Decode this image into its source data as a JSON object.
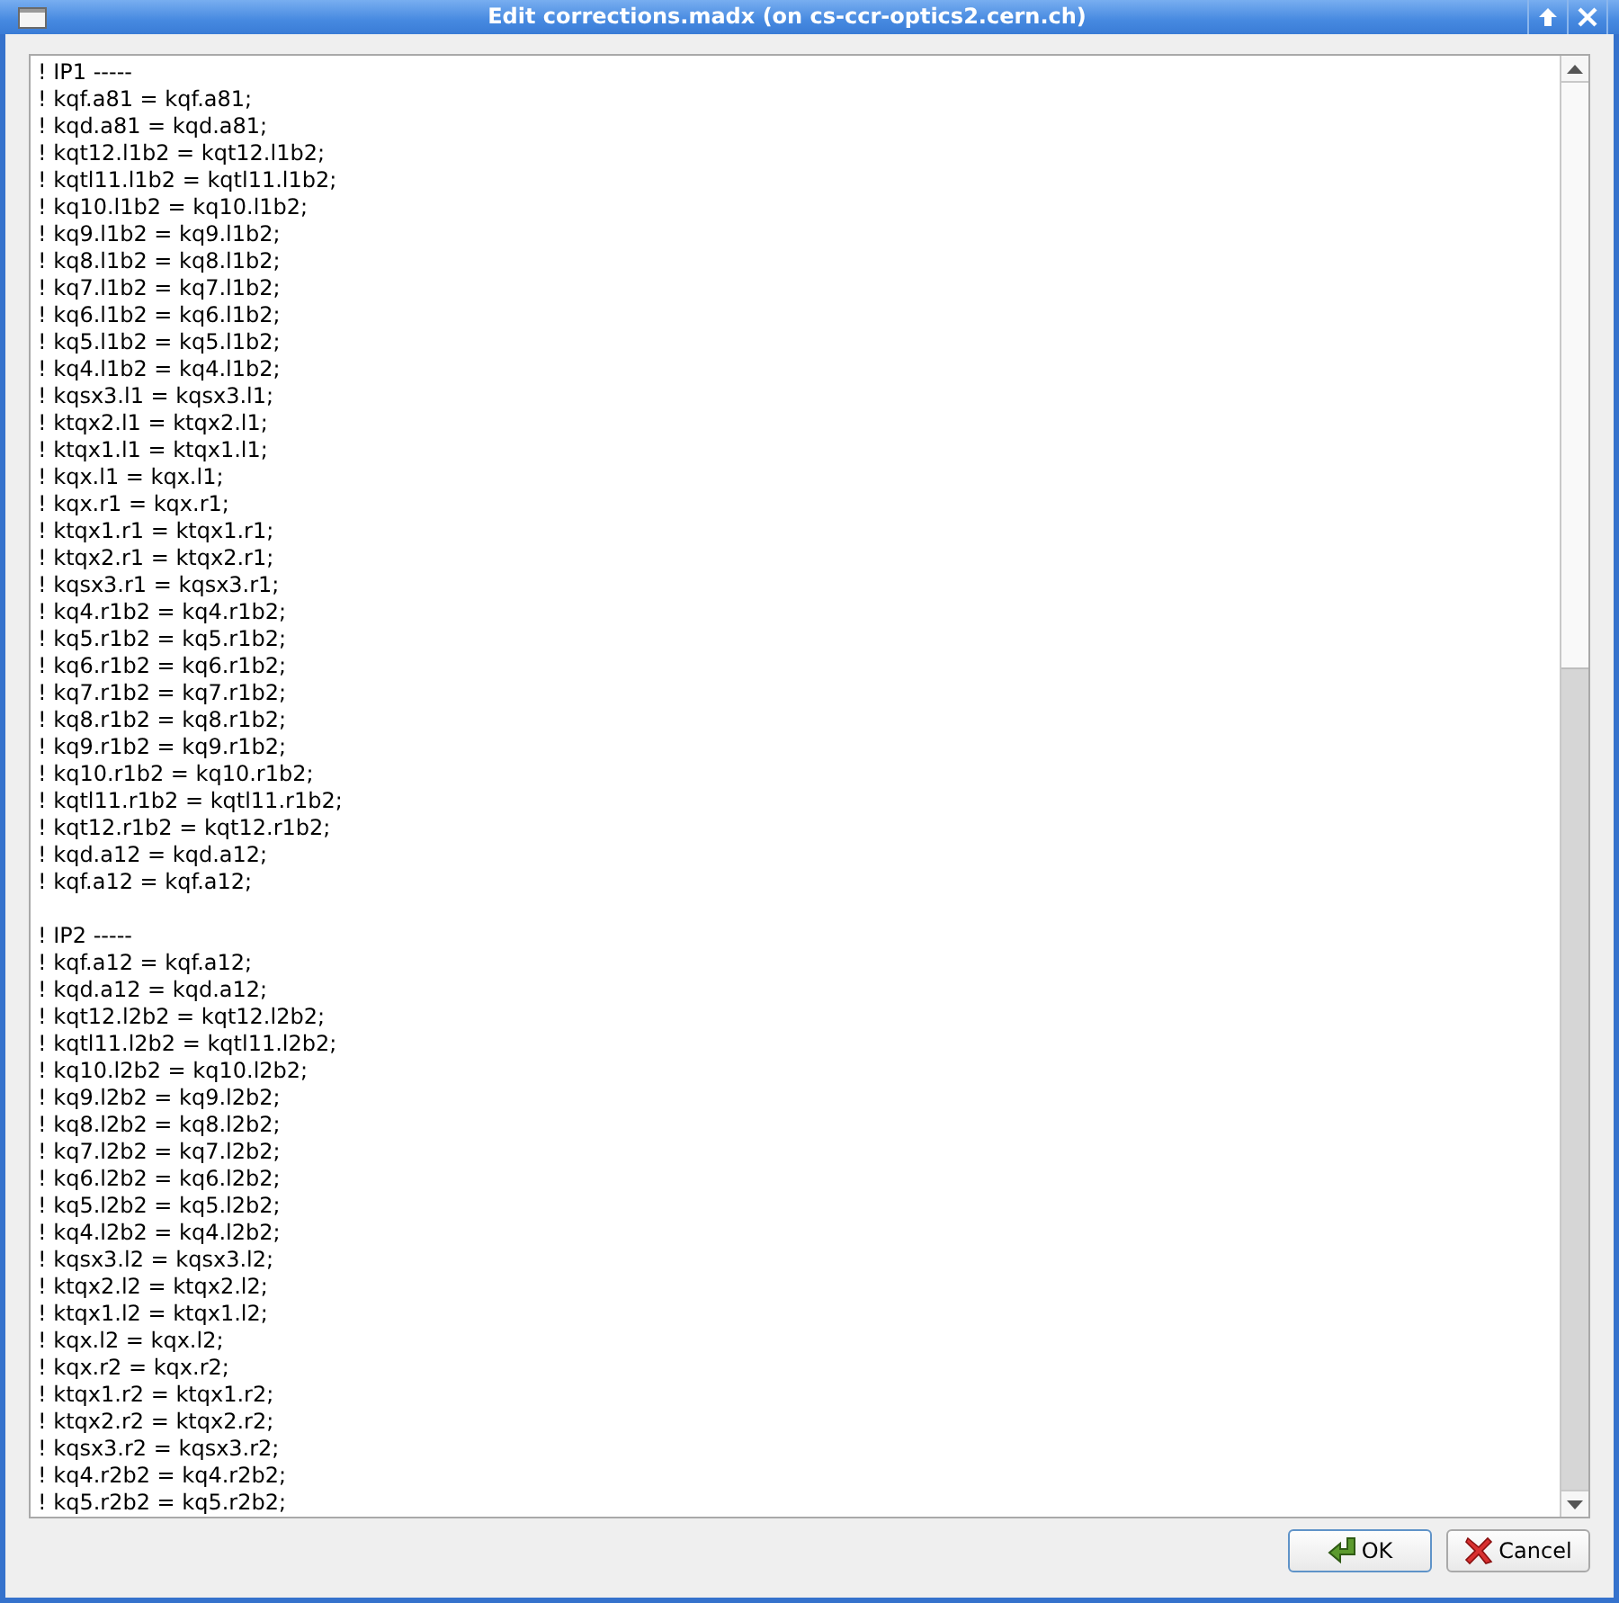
{
  "window": {
    "title": "Edit corrections.madx (on cs-ccr-optics2.cern.ch)"
  },
  "editor": {
    "sections": [
      {
        "header": "! IP1 -----",
        "lines": [
          "! kqf.a81 = kqf.a81;",
          "! kqd.a81 = kqd.a81;",
          "! kqt12.l1b2 = kqt12.l1b2;",
          "! kqtl11.l1b2 = kqtl11.l1b2;",
          "! kq10.l1b2 = kq10.l1b2;",
          "! kq9.l1b2 = kq9.l1b2;",
          "! kq8.l1b2 = kq8.l1b2;",
          "! kq7.l1b2 = kq7.l1b2;",
          "! kq6.l1b2 = kq6.l1b2;",
          "! kq5.l1b2 = kq5.l1b2;",
          "! kq4.l1b2 = kq4.l1b2;",
          "! kqsx3.l1 = kqsx3.l1;",
          "! ktqx2.l1 = ktqx2.l1;",
          "! ktqx1.l1 = ktqx1.l1;",
          "! kqx.l1 = kqx.l1;",
          "! kqx.r1 = kqx.r1;",
          "! ktqx1.r1 = ktqx1.r1;",
          "! ktqx2.r1 = ktqx2.r1;",
          "! kqsx3.r1 = kqsx3.r1;",
          "! kq4.r1b2 = kq4.r1b2;",
          "! kq5.r1b2 = kq5.r1b2;",
          "! kq6.r1b2 = kq6.r1b2;",
          "! kq7.r1b2 = kq7.r1b2;",
          "! kq8.r1b2 = kq8.r1b2;",
          "! kq9.r1b2 = kq9.r1b2;",
          "! kq10.r1b2 = kq10.r1b2;",
          "! kqtl11.r1b2 = kqtl11.r1b2;",
          "! kqt12.r1b2 = kqt12.r1b2;",
          "! kqd.a12 = kqd.a12;",
          "! kqf.a12 = kqf.a12;"
        ]
      },
      {
        "header": "! IP2 -----",
        "lines": [
          "! kqf.a12 = kqf.a12;",
          "! kqd.a12 = kqd.a12;",
          "! kqt12.l2b2 = kqt12.l2b2;",
          "! kqtl11.l2b2 = kqtl11.l2b2;",
          "! kq10.l2b2 = kq10.l2b2;",
          "! kq9.l2b2 = kq9.l2b2;",
          "! kq8.l2b2 = kq8.l2b2;",
          "! kq7.l2b2 = kq7.l2b2;",
          "! kq6.l2b2 = kq6.l2b2;",
          "! kq5.l2b2 = kq5.l2b2;",
          "! kq4.l2b2 = kq4.l2b2;",
          "! kqsx3.l2 = kqsx3.l2;",
          "! ktqx2.l2 = ktqx2.l2;",
          "! ktqx1.l2 = ktqx1.l2;",
          "! kqx.l2 = kqx.l2;",
          "! kqx.r2 = kqx.r2;",
          "! ktqx1.r2 = ktqx1.r2;",
          "! ktqx2.r2 = ktqx2.r2;",
          "! kqsx3.r2 = kqsx3.r2;",
          "! kq4.r2b2 = kq4.r2b2;",
          "! kq5.r2b2 = kq5.r2b2;"
        ]
      }
    ]
  },
  "buttons": [
    {
      "kind": "ok",
      "label": "OK",
      "default": true
    },
    {
      "kind": "cancel",
      "label": "Cancel",
      "default": false
    }
  ]
}
